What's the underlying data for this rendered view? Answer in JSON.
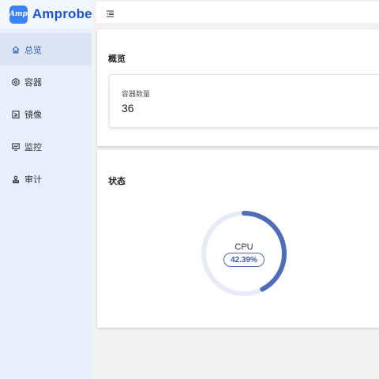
{
  "app": {
    "name": "Amprobe",
    "logo_text": "Amp"
  },
  "sidebar": {
    "items": [
      {
        "label": "总览",
        "icon": "home-icon",
        "active": true
      },
      {
        "label": "容器",
        "icon": "container-icon",
        "active": false
      },
      {
        "label": "镜像",
        "icon": "image-icon",
        "active": false
      },
      {
        "label": "监控",
        "icon": "monitor-icon",
        "active": false
      },
      {
        "label": "审计",
        "icon": "audit-icon",
        "active": false
      }
    ]
  },
  "topbar": {
    "toggle_icon": "menu-fold-icon"
  },
  "overview": {
    "title": "概览",
    "stat": {
      "label": "容器数量",
      "value": "36"
    }
  },
  "status": {
    "title": "状态",
    "cpu": {
      "label": "CPU",
      "value_text": "42.39%",
      "percent": 42.39
    }
  },
  "colors": {
    "accent": "#4e6cb8",
    "track": "#e6ebf7",
    "sidebar_bg": "#e8eefb",
    "logo_badge": "#3b82f6",
    "brand_text": "#1f56c9"
  }
}
